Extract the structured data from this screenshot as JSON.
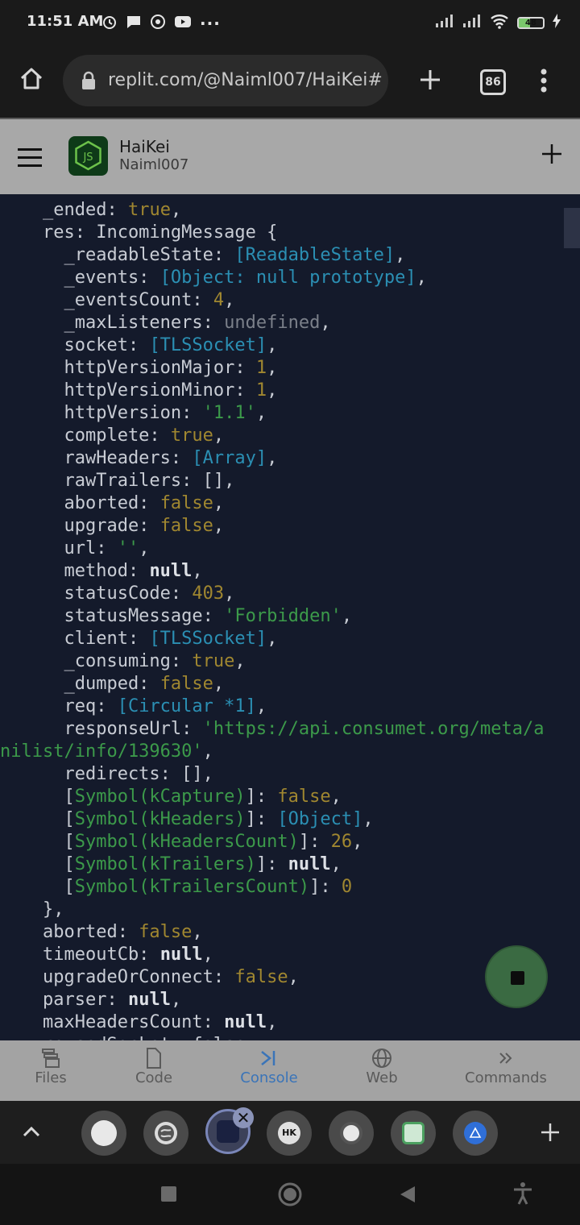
{
  "status_bar": {
    "time": "11:51 AM",
    "battery": "48",
    "overflow": "···"
  },
  "browser": {
    "url": "replit.com/@Naiml007/HaiKei#",
    "tab_count": "86"
  },
  "repl": {
    "title": "HaiKei",
    "owner": "Naiml007"
  },
  "console": {
    "lines": [
      [
        {
          "t": "    _ended: ",
          "c": "key"
        },
        {
          "t": "true",
          "c": "bool"
        },
        {
          "t": ",",
          "c": "key"
        }
      ],
      [
        {
          "t": "    res: IncomingMessage {",
          "c": "key"
        }
      ],
      [
        {
          "t": "      _readableState: ",
          "c": "key"
        },
        {
          "t": "[ReadableState]",
          "c": "ref"
        },
        {
          "t": ",",
          "c": "key"
        }
      ],
      [
        {
          "t": "      _events: ",
          "c": "key"
        },
        {
          "t": "[Object: null prototype]",
          "c": "ref"
        },
        {
          "t": ",",
          "c": "key"
        }
      ],
      [
        {
          "t": "      _eventsCount: ",
          "c": "key"
        },
        {
          "t": "4",
          "c": "num"
        },
        {
          "t": ",",
          "c": "key"
        }
      ],
      [
        {
          "t": "      _maxListeners: ",
          "c": "key"
        },
        {
          "t": "undefined",
          "c": "und"
        },
        {
          "t": ",",
          "c": "key"
        }
      ],
      [
        {
          "t": "      socket: ",
          "c": "key"
        },
        {
          "t": "[TLSSocket]",
          "c": "ref"
        },
        {
          "t": ",",
          "c": "key"
        }
      ],
      [
        {
          "t": "      httpVersionMajor: ",
          "c": "key"
        },
        {
          "t": "1",
          "c": "num"
        },
        {
          "t": ",",
          "c": "key"
        }
      ],
      [
        {
          "t": "      httpVersionMinor: ",
          "c": "key"
        },
        {
          "t": "1",
          "c": "num"
        },
        {
          "t": ",",
          "c": "key"
        }
      ],
      [
        {
          "t": "      httpVersion: ",
          "c": "key"
        },
        {
          "t": "'1.1'",
          "c": "str"
        },
        {
          "t": ",",
          "c": "key"
        }
      ],
      [
        {
          "t": "      complete: ",
          "c": "key"
        },
        {
          "t": "true",
          "c": "bool"
        },
        {
          "t": ",",
          "c": "key"
        }
      ],
      [
        {
          "t": "      rawHeaders: ",
          "c": "key"
        },
        {
          "t": "[Array]",
          "c": "ref"
        },
        {
          "t": ",",
          "c": "key"
        }
      ],
      [
        {
          "t": "      rawTrailers: [],",
          "c": "key"
        }
      ],
      [
        {
          "t": "      aborted: ",
          "c": "key"
        },
        {
          "t": "false",
          "c": "bool"
        },
        {
          "t": ",",
          "c": "key"
        }
      ],
      [
        {
          "t": "      upgrade: ",
          "c": "key"
        },
        {
          "t": "false",
          "c": "bool"
        },
        {
          "t": ",",
          "c": "key"
        }
      ],
      [
        {
          "t": "      url: ",
          "c": "key"
        },
        {
          "t": "''",
          "c": "str"
        },
        {
          "t": ",",
          "c": "key"
        }
      ],
      [
        {
          "t": "      method: ",
          "c": "key"
        },
        {
          "t": "null",
          "c": "null"
        },
        {
          "t": ",",
          "c": "key"
        }
      ],
      [
        {
          "t": "      statusCode: ",
          "c": "key"
        },
        {
          "t": "403",
          "c": "num"
        },
        {
          "t": ",",
          "c": "key"
        }
      ],
      [
        {
          "t": "      statusMessage: ",
          "c": "key"
        },
        {
          "t": "'Forbidden'",
          "c": "str"
        },
        {
          "t": ",",
          "c": "key"
        }
      ],
      [
        {
          "t": "      client: ",
          "c": "key"
        },
        {
          "t": "[TLSSocket]",
          "c": "ref"
        },
        {
          "t": ",",
          "c": "key"
        }
      ],
      [
        {
          "t": "      _consuming: ",
          "c": "key"
        },
        {
          "t": "true",
          "c": "bool"
        },
        {
          "t": ",",
          "c": "key"
        }
      ],
      [
        {
          "t": "      _dumped: ",
          "c": "key"
        },
        {
          "t": "false",
          "c": "bool"
        },
        {
          "t": ",",
          "c": "key"
        }
      ],
      [
        {
          "t": "      req: ",
          "c": "key"
        },
        {
          "t": "[Circular *1]",
          "c": "ref"
        },
        {
          "t": ",",
          "c": "key"
        }
      ],
      [
        {
          "t": "      responseUrl: ",
          "c": "key"
        },
        {
          "t": "'https://api.consumet.org/meta/a",
          "c": "str"
        }
      ],
      [
        {
          "t": "nilist/info/139630'",
          "c": "str"
        },
        {
          "t": ",",
          "c": "key"
        }
      ],
      [
        {
          "t": "      redirects: [],",
          "c": "key"
        }
      ],
      [
        {
          "t": "      [",
          "c": "key"
        },
        {
          "t": "Symbol(kCapture)",
          "c": "sym"
        },
        {
          "t": "]: ",
          "c": "key"
        },
        {
          "t": "false",
          "c": "bool"
        },
        {
          "t": ",",
          "c": "key"
        }
      ],
      [
        {
          "t": "      [",
          "c": "key"
        },
        {
          "t": "Symbol(kHeaders)",
          "c": "sym"
        },
        {
          "t": "]: ",
          "c": "key"
        },
        {
          "t": "[Object]",
          "c": "ref"
        },
        {
          "t": ",",
          "c": "key"
        }
      ],
      [
        {
          "t": "      [",
          "c": "key"
        },
        {
          "t": "Symbol(kHeadersCount)",
          "c": "sym"
        },
        {
          "t": "]: ",
          "c": "key"
        },
        {
          "t": "26",
          "c": "num"
        },
        {
          "t": ",",
          "c": "key"
        }
      ],
      [
        {
          "t": "      [",
          "c": "key"
        },
        {
          "t": "Symbol(kTrailers)",
          "c": "sym"
        },
        {
          "t": "]: ",
          "c": "key"
        },
        {
          "t": "null",
          "c": "null"
        },
        {
          "t": ",",
          "c": "key"
        }
      ],
      [
        {
          "t": "      [",
          "c": "key"
        },
        {
          "t": "Symbol(kTrailersCount)",
          "c": "sym"
        },
        {
          "t": "]: ",
          "c": "key"
        },
        {
          "t": "0",
          "c": "num"
        }
      ],
      [
        {
          "t": "    },",
          "c": "key"
        }
      ],
      [
        {
          "t": "    aborted: ",
          "c": "key"
        },
        {
          "t": "false",
          "c": "bool"
        },
        {
          "t": ",",
          "c": "key"
        }
      ],
      [
        {
          "t": "    timeoutCb: ",
          "c": "key"
        },
        {
          "t": "null",
          "c": "null"
        },
        {
          "t": ",",
          "c": "key"
        }
      ],
      [
        {
          "t": "    upgradeOrConnect: ",
          "c": "key"
        },
        {
          "t": "false",
          "c": "bool"
        },
        {
          "t": ",",
          "c": "key"
        }
      ],
      [
        {
          "t": "    parser: ",
          "c": "key"
        },
        {
          "t": "null",
          "c": "null"
        },
        {
          "t": ",",
          "c": "key"
        }
      ],
      [
        {
          "t": "    maxHeadersCount: ",
          "c": "key"
        },
        {
          "t": "null",
          "c": "null"
        },
        {
          "t": ",",
          "c": "key"
        }
      ],
      [
        {
          "t": "    reusedSocket: false,",
          "c": "key"
        }
      ]
    ]
  },
  "tabs": [
    {
      "label": "Files",
      "icon": "files-icon"
    },
    {
      "label": "Code",
      "icon": "file-icon"
    },
    {
      "label": "Console",
      "icon": "console-icon",
      "active": true
    },
    {
      "label": "Web",
      "icon": "globe-icon"
    },
    {
      "label": "Commands",
      "icon": "chevrons-right-icon"
    }
  ],
  "bubbles": {
    "hk_label": "HK"
  },
  "colors": {
    "console_bg": "#141a2b",
    "bool": "#a08730",
    "string": "#3c9a4a",
    "ref": "#2b8fb3",
    "active_tab": "#3a74b8"
  }
}
